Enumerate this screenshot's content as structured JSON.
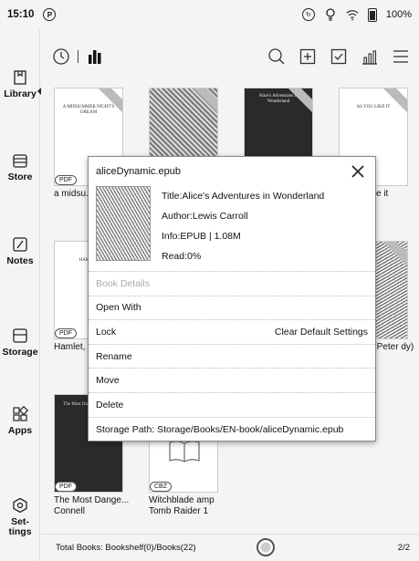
{
  "status": {
    "time": "15:10",
    "battery": "100%"
  },
  "sidebar": {
    "items": [
      {
        "label": "Library",
        "icon": "library-icon"
      },
      {
        "label": "Store",
        "icon": "store-icon"
      },
      {
        "label": "Notes",
        "icon": "notes-icon"
      },
      {
        "label": "Storage",
        "icon": "storage-icon"
      },
      {
        "label": "Apps",
        "icon": "apps-icon"
      },
      {
        "label": "Set-\ntings",
        "icon": "settings-icon"
      }
    ]
  },
  "books": [
    {
      "title": "a midsu... night's d",
      "badge": "PDF",
      "cover_text": "A MIDSUMMER NIGHT'S DREAM"
    },
    {
      "title": "",
      "badge": "",
      "cover_text": ""
    },
    {
      "title": "",
      "badge": "",
      "cover_text": "Alice's Adventures in Wonderland"
    },
    {
      "title": "e it",
      "badge": "",
      "cover_text": "AS YOU LIKE IT"
    },
    {
      "title": "Hamlet, of Denm",
      "badge": "PDF",
      "cover_text": "HAMLET"
    },
    {
      "title": "",
      "badge": "",
      "cover_text": ""
    },
    {
      "title": "",
      "badge": "",
      "cover_text": ""
    },
    {
      "title": "n (Peter dy)",
      "badge": "",
      "cover_text": ""
    },
    {
      "title": "The Most Dange... Connell",
      "badge": "PDF",
      "cover_text": "The Most Dangerous Game"
    },
    {
      "title": "Witchblade amp Tomb Raider 1",
      "badge": "CBZ",
      "cover_text": ""
    }
  ],
  "dialog": {
    "filename": "aliceDynamic.epub",
    "title": "Title:Alice's Adventures in Wonderland",
    "author": "Author:Lewis Carroll",
    "info": "Info:EPUB | 1.08M",
    "read": "Read:0%",
    "menu": {
      "book_details": "Book Details",
      "open_with": "Open With",
      "lock": "Lock",
      "clear_default": "Clear Default Settings",
      "rename": "Rename",
      "move": "Move",
      "delete": "Delete",
      "storage_path": "Storage Path: Storage/Books/EN-book/aliceDynamic.epub"
    }
  },
  "footer": {
    "total": "Total Books:  Bookshelf(0)/Books(22)",
    "page": "2/2"
  }
}
